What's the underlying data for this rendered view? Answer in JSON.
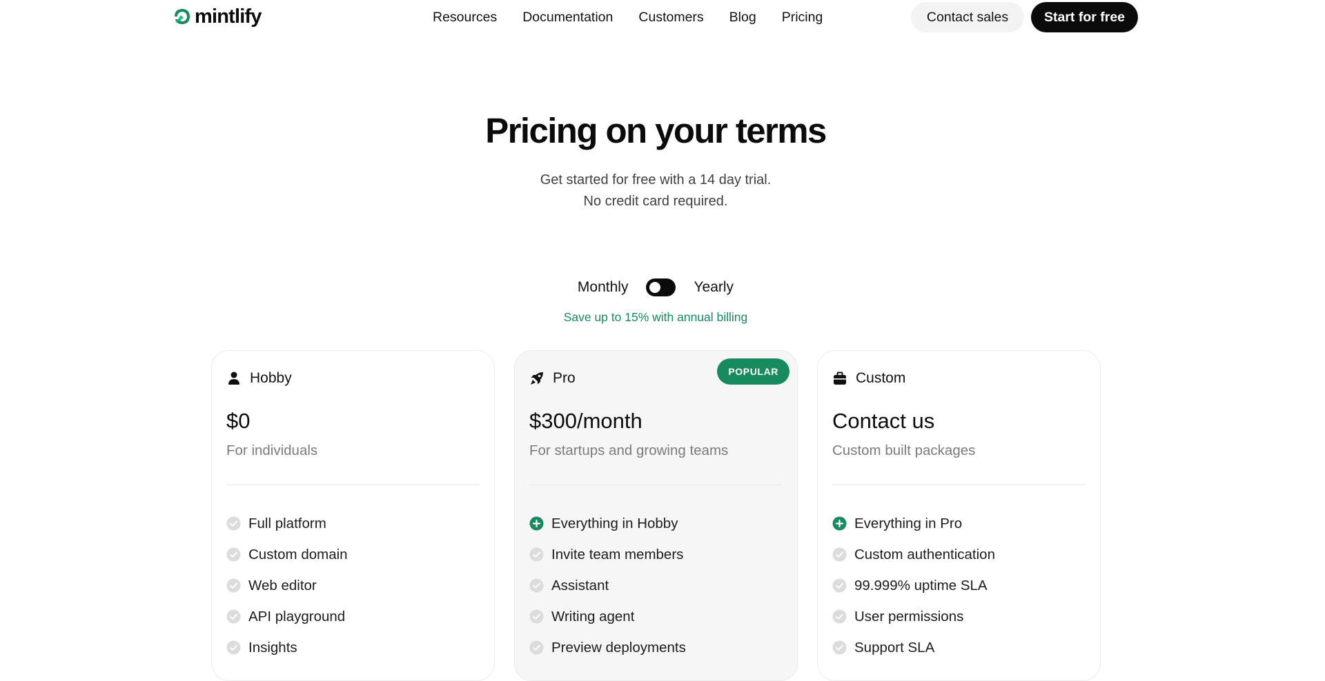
{
  "nav": {
    "logo_text": "mintlify",
    "links": [
      "Resources",
      "Documentation",
      "Customers",
      "Blog",
      "Pricing"
    ],
    "contact_sales": "Contact sales",
    "start_free": "Start for free"
  },
  "hero": {
    "title": "Pricing on your terms",
    "subtitle_line1": "Get started for free with a 14 day trial.",
    "subtitle_line2": "No credit card required."
  },
  "billing": {
    "monthly": "Monthly",
    "yearly": "Yearly",
    "selected": "Monthly",
    "save_note": "Save up to 15% with annual billing"
  },
  "colors": {
    "brand_green": "#178a5e",
    "primary_black": "#0b0b0b"
  },
  "plans": [
    {
      "name": "Hobby",
      "icon": "user-icon",
      "price": "$0",
      "description": "For individuals",
      "features": [
        "Full platform",
        "Custom domain",
        "Web editor",
        "API playground",
        "Insights"
      ],
      "first_feature_highlighted": false
    },
    {
      "name": "Pro",
      "icon": "rocket-icon",
      "badge": "POPULAR",
      "price": "$300/month",
      "description": "For startups and growing teams",
      "features": [
        "Everything in Hobby",
        "Invite team members",
        "Assistant",
        "Writing agent",
        "Preview deployments"
      ],
      "first_feature_highlighted": true
    },
    {
      "name": "Custom",
      "icon": "briefcase-icon",
      "price": "Contact us",
      "description": "Custom built packages",
      "features": [
        "Everything in Pro",
        "Custom authentication",
        "99.999% uptime SLA",
        "User permissions",
        "Support SLA"
      ],
      "first_feature_highlighted": true
    }
  ]
}
